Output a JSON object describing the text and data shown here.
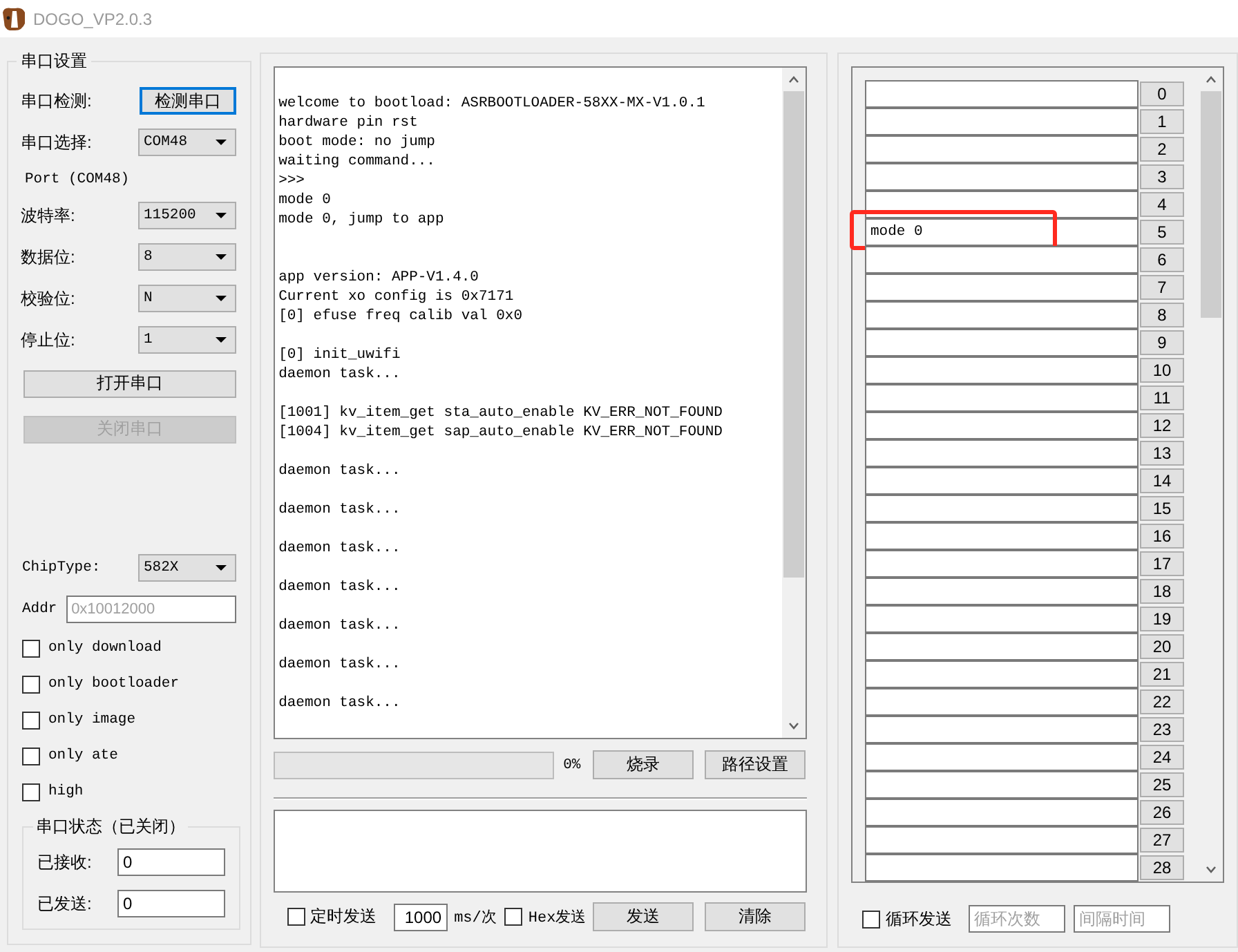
{
  "window": {
    "title": "DOGO_VP2.0.3"
  },
  "serial_settings": {
    "title": "串口设置",
    "rows": [
      {
        "kind": "button",
        "label": "串口检测:",
        "button": "检测串口",
        "focused": true
      },
      {
        "kind": "select",
        "label": "串口选择:",
        "value": "COM48"
      },
      {
        "kind": "text",
        "text": "Port (COM48)"
      },
      {
        "kind": "select",
        "label": "波特率:",
        "value": "115200"
      },
      {
        "kind": "select",
        "label": "数据位:",
        "value": "8"
      },
      {
        "kind": "select",
        "label": "校验位:",
        "value": "N"
      },
      {
        "kind": "select",
        "label": "停止位:",
        "value": "1"
      },
      {
        "kind": "wide_button",
        "label": "打开串口",
        "disabled": false
      },
      {
        "kind": "wide_button",
        "label": "关闭串口",
        "disabled": true
      }
    ],
    "options": [
      {
        "kind": "select",
        "label": "ChipType:",
        "value": "582X"
      },
      {
        "kind": "field",
        "label": "Addr",
        "placeholder": "0x10012000"
      },
      {
        "kind": "checkbox",
        "label": "only download",
        "checked": false
      },
      {
        "kind": "checkbox",
        "label": "only bootloader",
        "checked": false
      },
      {
        "kind": "checkbox",
        "label": "only image",
        "checked": false
      },
      {
        "kind": "checkbox",
        "label": "only ate",
        "checked": false
      },
      {
        "kind": "checkbox",
        "label": "high",
        "checked": false
      }
    ],
    "status": {
      "title": "串口状态（已关闭）",
      "rows": [
        {
          "label": "已接收:",
          "value": "0"
        },
        {
          "label": "已发送:",
          "value": "0"
        }
      ]
    }
  },
  "log": {
    "text": "welcome to bootload: ASRBOOTLOADER-58XX-MX-V1.0.1\nhardware pin rst\nboot mode: no jump\nwaiting command...\n>>>\nmode 0\nmode 0, jump to app\n\n\napp version: APP-V1.4.0\nCurrent xo config is 0x7171\n[0] efuse freq calib val 0x0\n\n[0] init_uwifi\ndaemon task...\n\n[1001] kv_item_get sta_auto_enable KV_ERR_NOT_FOUND\n[1004] kv_item_get sap_auto_enable KV_ERR_NOT_FOUND\n\ndaemon task...\n\ndaemon task...\n\ndaemon task...\n\ndaemon task...\n\ndaemon task...\n\ndaemon task...\n\ndaemon task..."
  },
  "progress": {
    "level": 0,
    "reading": "0%",
    "buttons": [
      {
        "label": "烧录"
      },
      {
        "label": "路径设置"
      }
    ]
  },
  "send_controls": {
    "timed_send": {
      "label": "定时发送",
      "checked": false
    },
    "interval": {
      "value": "1000"
    },
    "unit": "ms/次",
    "hex_send": {
      "label": "Hex发送",
      "checked": false
    },
    "buttons": [
      {
        "label": "发送"
      },
      {
        "label": "清除"
      }
    ]
  },
  "quick_send": {
    "rows": [
      {
        "button": "0",
        "highlighted": false
      },
      {
        "button": "1",
        "highlighted": false
      },
      {
        "button": "2",
        "highlighted": false
      },
      {
        "button": "3",
        "highlighted": false
      },
      {
        "button": "4",
        "highlighted": false
      },
      {
        "value": "mode 0",
        "button": "5",
        "highlighted": true
      },
      {
        "button": "6",
        "highlighted": false
      },
      {
        "button": "7",
        "highlighted": false
      },
      {
        "button": "8",
        "highlighted": false
      },
      {
        "button": "9",
        "highlighted": false
      },
      {
        "button": "10",
        "highlighted": false
      },
      {
        "button": "11",
        "highlighted": false
      },
      {
        "button": "12",
        "highlighted": false
      },
      {
        "button": "13",
        "highlighted": false
      },
      {
        "button": "14",
        "highlighted": false
      },
      {
        "button": "15",
        "highlighted": false
      },
      {
        "button": "16",
        "highlighted": false
      },
      {
        "button": "17",
        "highlighted": false
      },
      {
        "button": "18",
        "highlighted": false
      },
      {
        "button": "19",
        "highlighted": false
      },
      {
        "button": "20",
        "highlighted": false
      },
      {
        "button": "21",
        "highlighted": false
      },
      {
        "button": "22",
        "highlighted": false
      },
      {
        "button": "23",
        "highlighted": false
      },
      {
        "button": "24",
        "highlighted": false
      },
      {
        "button": "25",
        "highlighted": false
      },
      {
        "button": "26",
        "highlighted": false
      },
      {
        "button": "27",
        "highlighted": false
      },
      {
        "button": "28",
        "highlighted": false
      }
    ],
    "loop": {
      "checkbox": {
        "label": "循环发送",
        "checked": false
      },
      "count_field": {
        "placeholder": "循环次数"
      },
      "interval_field": {
        "placeholder": "间隔时间"
      }
    }
  }
}
